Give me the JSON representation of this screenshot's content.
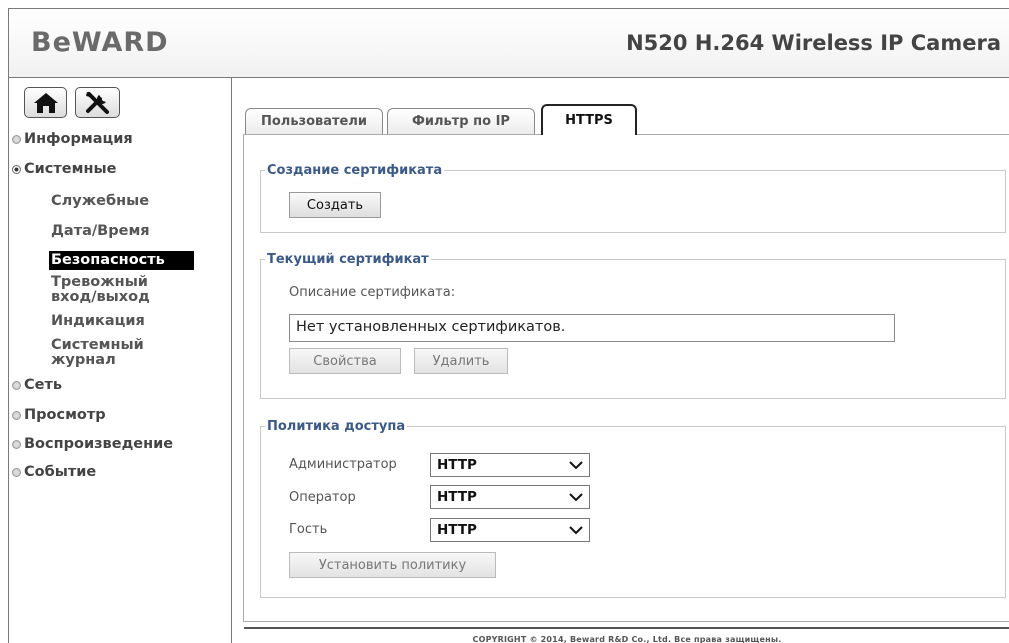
{
  "header": {
    "logo": "BeWARD",
    "product_title": "N520 H.264 Wireless IP Camera"
  },
  "sidebar": {
    "home_icon": "home-icon",
    "tools_icon": "tools-icon",
    "menu": [
      {
        "label": "Информация",
        "expanded": false
      },
      {
        "label": "Системные",
        "expanded": true
      },
      {
        "label": "Сеть",
        "expanded": false
      },
      {
        "label": "Просмотр",
        "expanded": false
      },
      {
        "label": "Воспроизведение",
        "expanded": false
      },
      {
        "label": "Событие",
        "expanded": false
      }
    ],
    "system_items": [
      "Служебные",
      "Дата/Время",
      "Безопасность",
      "Тревожный вход/выход",
      "Индикация",
      "Системный журнал"
    ],
    "active_item": "Безопасность"
  },
  "tabs": [
    {
      "label": "Пользователи",
      "active": false
    },
    {
      "label": "Фильтр по IP",
      "active": false
    },
    {
      "label": "HTTPS",
      "active": true
    }
  ],
  "create_cert": {
    "legend": "Создание сертификата",
    "button": "Создать"
  },
  "current_cert": {
    "legend": "Текущий сертификат",
    "description_label": "Описание сертификата:",
    "value": "Нет установленных сертификатов.",
    "properties_button": "Свойства",
    "delete_button": "Удалить"
  },
  "policy": {
    "legend": "Политика доступа",
    "rows": [
      {
        "label": "Администратор",
        "value": "HTTP"
      },
      {
        "label": "Оператор",
        "value": "HTTP"
      },
      {
        "label": "Гость",
        "value": "HTTP"
      }
    ],
    "apply_button": "Установить политику"
  },
  "footer": {
    "copyright": "COPYRIGHT © 2014, Beward R&D Co., Ltd. Все права защищены."
  }
}
